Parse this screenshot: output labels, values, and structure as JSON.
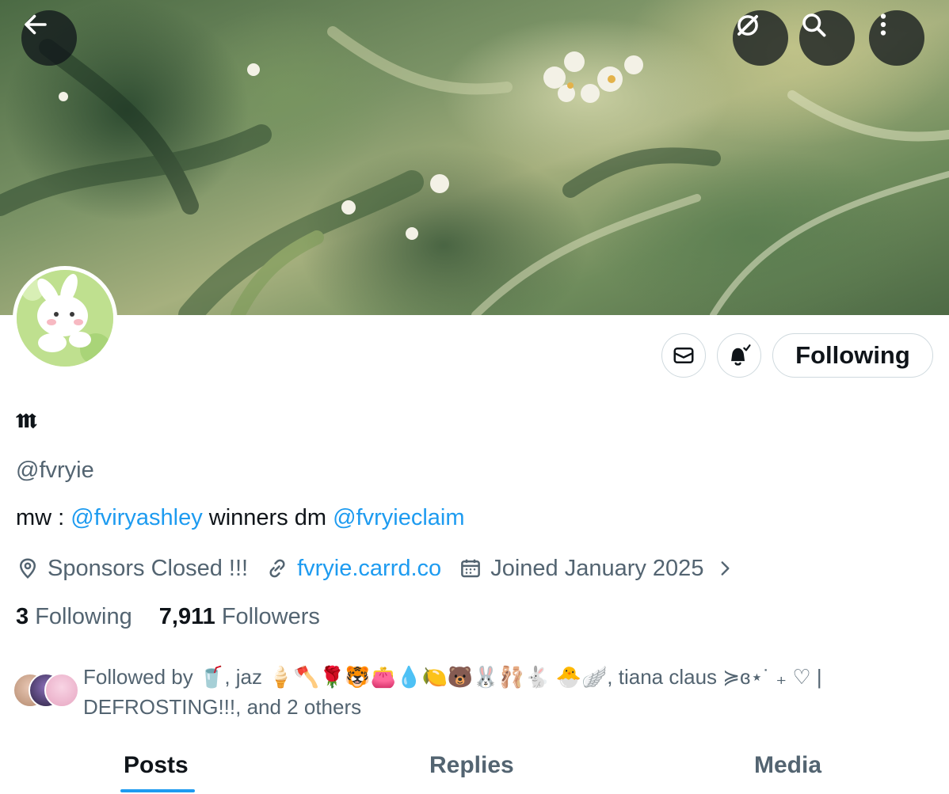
{
  "top_bar": {
    "back_icon": "arrow-left-icon",
    "icons": [
      "grok-icon",
      "search-icon",
      "more-vertical-icon"
    ]
  },
  "profile": {
    "display_name": "𝖒",
    "handle": "@fvryie",
    "bio": {
      "prefix": "mw : ",
      "mention_1": "@fviryashley",
      "middle": " winners dm ",
      "mention_2": "@fvryieclaim"
    },
    "location": "Sponsors Closed !!!",
    "website": "fvryie.carrd.co",
    "joined": "Joined January 2025",
    "following_count": "3",
    "following_label": "Following",
    "followers_count": "7,911",
    "followers_label": "Followers"
  },
  "actions": {
    "message_icon": "envelope-icon",
    "notify_icon": "bell-check-icon",
    "follow_button_label": "Following"
  },
  "followed_by": {
    "text_line_1": "Followed by 🥤, jaz 🍦🪓🌹🐯👛💧🍋🐻🐰🩰🐇 🐣🪽, tiana claus ≽ɞ⋆˙ ₊ ♡ |",
    "text_line_2": "DEFROSTING!!!, and 2 others"
  },
  "tabs": [
    {
      "label": "Posts",
      "active": true
    },
    {
      "label": "Replies",
      "active": false
    },
    {
      "label": "Media",
      "active": false
    }
  ],
  "colors": {
    "accent": "#1d9bf0",
    "text_primary": "#0f1419",
    "text_secondary": "#536471",
    "border": "#cfd9de"
  }
}
